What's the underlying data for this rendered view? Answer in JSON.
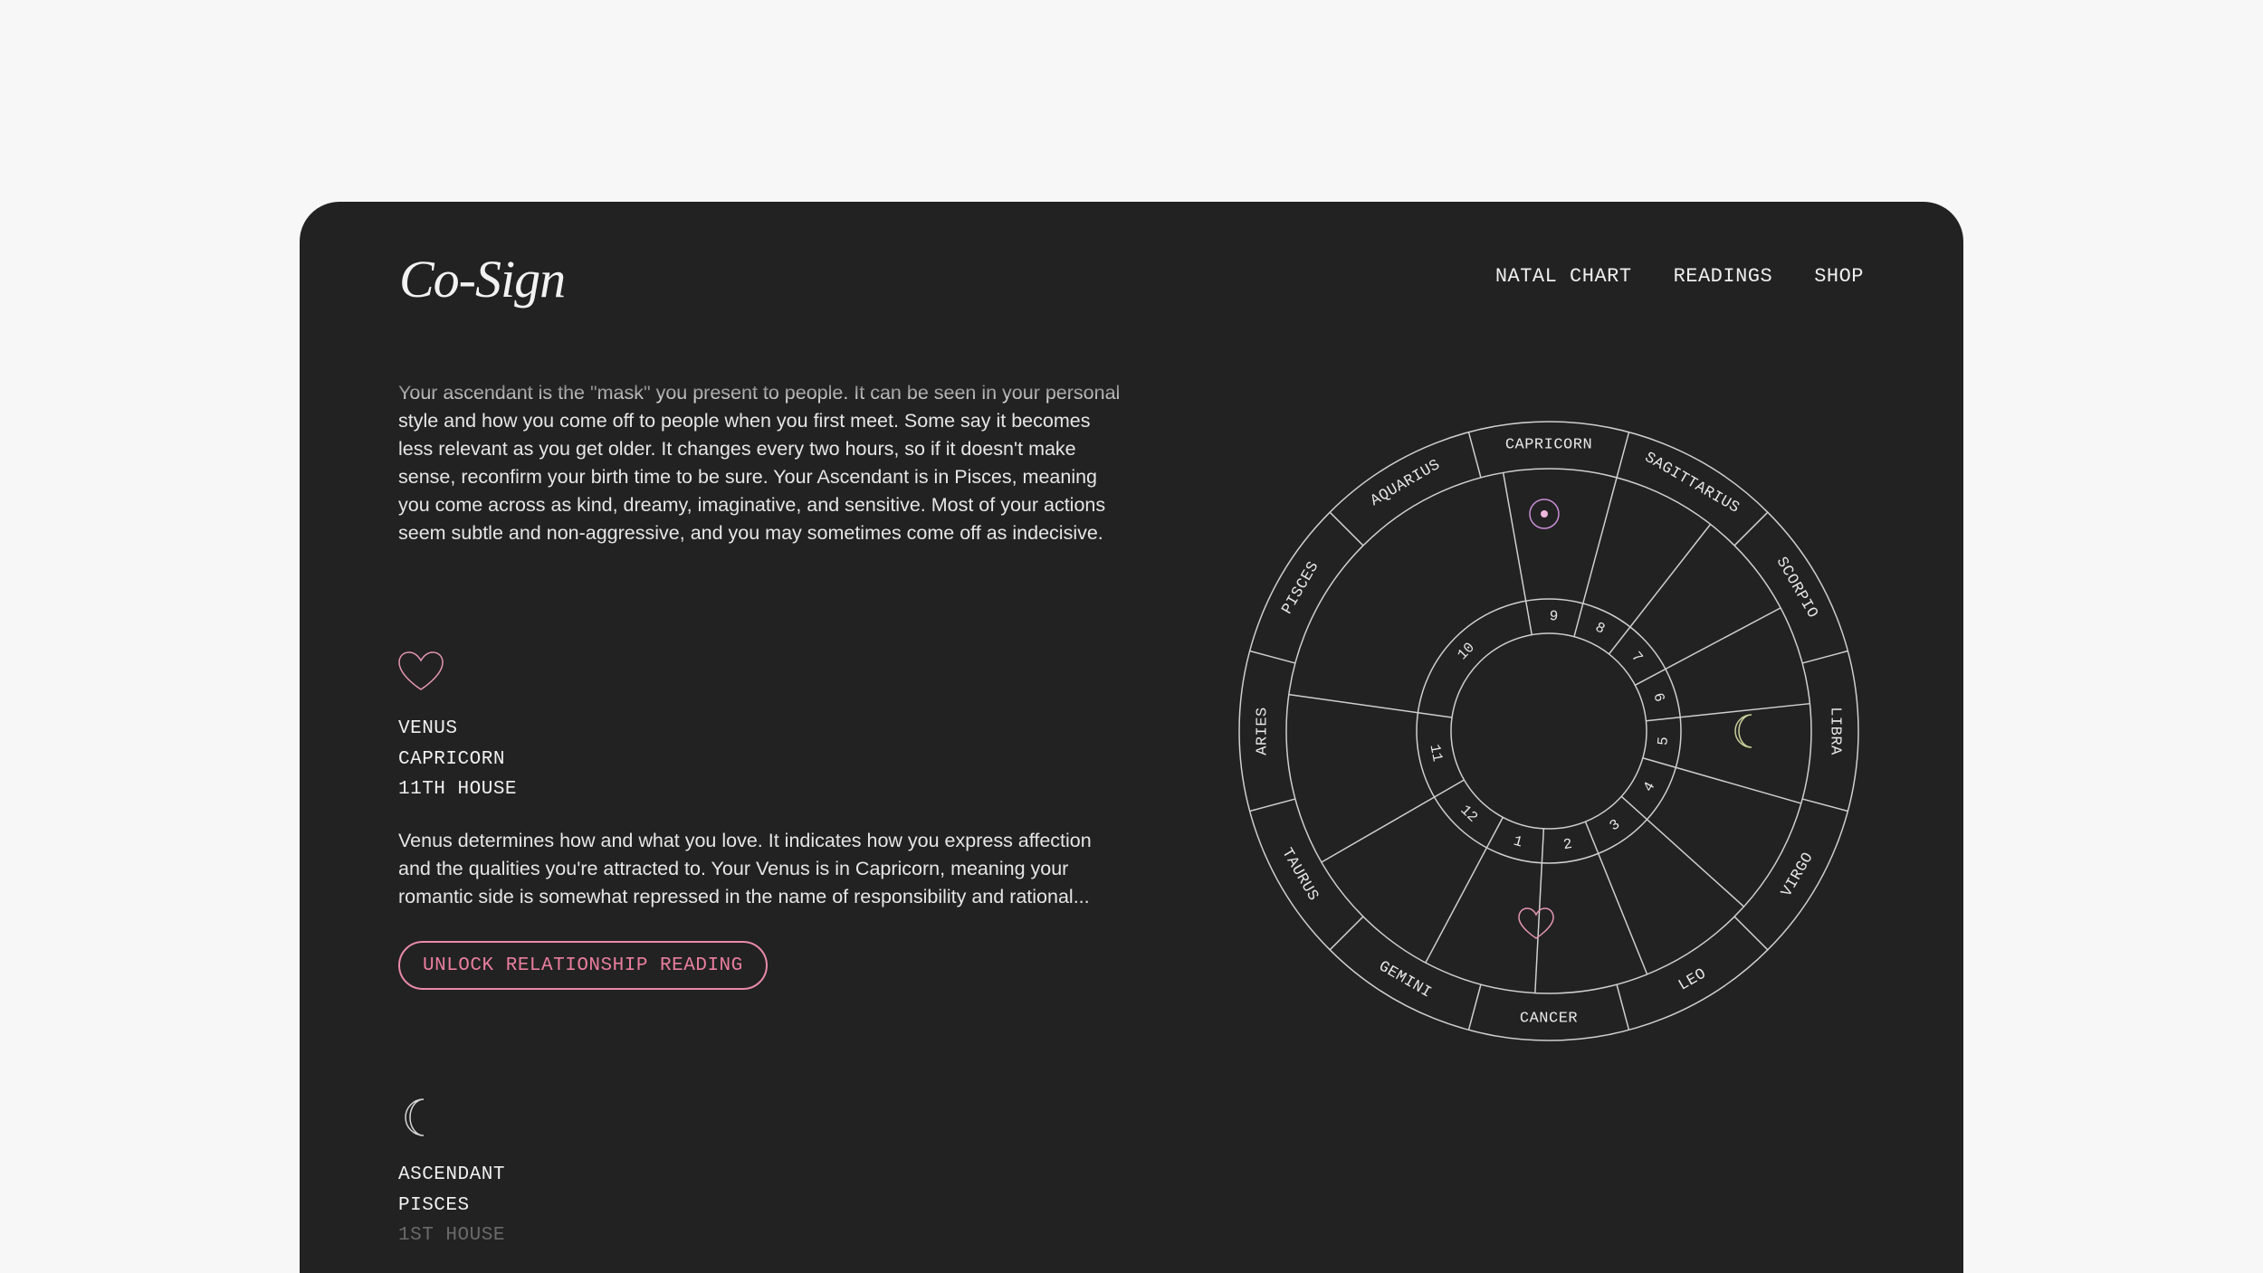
{
  "header": {
    "logo": "Co-Sign",
    "nav": [
      "NATAL CHART",
      "READINGS",
      "SHOP"
    ]
  },
  "ascendant_intro": {
    "text": "Your ascendant is the \"mask\" you present to people. It can be seen in your personal style and how you come off to people when you first meet. Some say it becomes less relevant as you get older. It changes every two hours, so if it doesn't make sense, reconfirm your birth time to be sure. Your Ascendant is in Pisces, meaning you come across as kind, dreamy, imaginative, and sensitive. Most of your actions seem subtle and non-aggressive, and you may sometimes come off as indecisive."
  },
  "venus": {
    "icon": "heart-icon",
    "planet": "VENUS",
    "sign": "CAPRICORN",
    "house": "11TH HOUSE",
    "description": "Venus determines how and what you love. It indicates how you express affection and the qualities you're attracted to. Your Venus is in Capricorn, meaning your romantic side is somewhat repressed in the name of responsibility and rational...",
    "cta": "UNLOCK RELATIONSHIP READING"
  },
  "ascendant": {
    "icon": "moon-icon",
    "planet": "ASCENDANT",
    "sign": "PISCES",
    "house": "1ST HOUSE"
  },
  "wheel": {
    "signs": [
      "CAPRICORN",
      "SAGITTARIUS",
      "SCORPIO",
      "LIBRA",
      "VIRGO",
      "LEO",
      "CANCER",
      "GEMINI",
      "TAURUS",
      "ARIES",
      "PISCES",
      "AQUARIUS"
    ],
    "houses": [
      "10",
      "9",
      "8",
      "7",
      "6",
      "5",
      "4",
      "3",
      "2",
      "1",
      "12",
      "11"
    ],
    "markers": [
      {
        "icon": "sun-icon",
        "sign": "CAPRICORN"
      },
      {
        "icon": "moon-icon",
        "sign": "LIBRA"
      },
      {
        "icon": "heart-icon",
        "sign": "CANCER"
      }
    ]
  },
  "colors": {
    "background": "#f7f7f7",
    "card": "#222222",
    "accent_pink": "#ea7e9e",
    "sun": "#c98fd6",
    "moon": "#c9cf9a",
    "venus": "#e596b4"
  }
}
